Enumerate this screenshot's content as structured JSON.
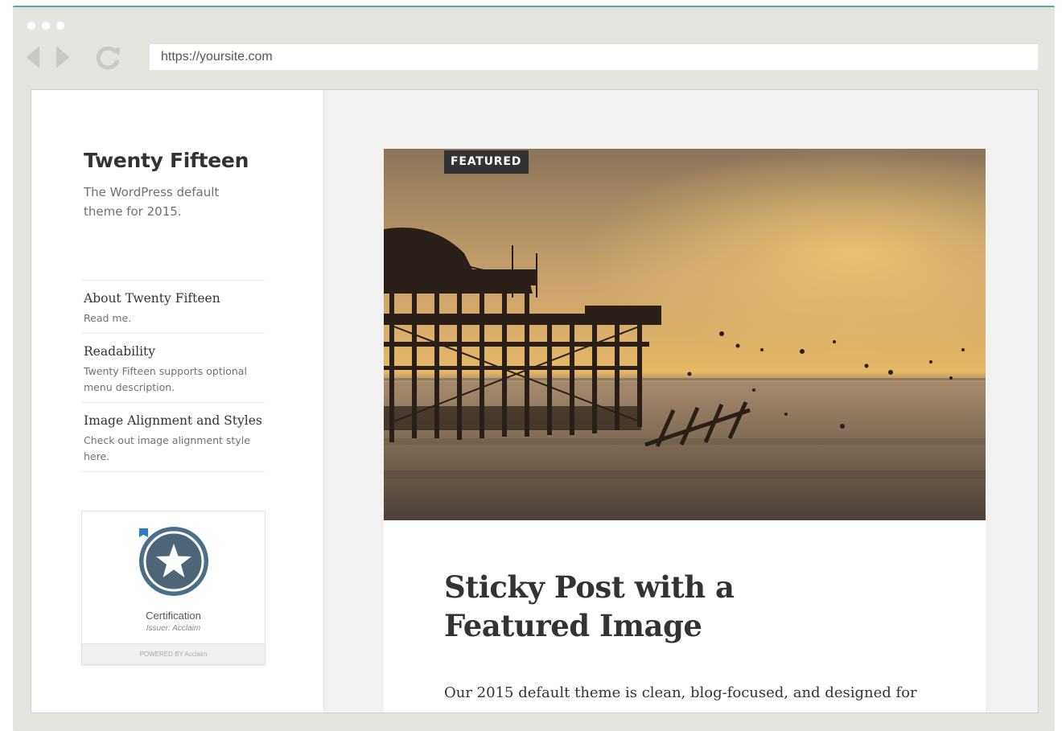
{
  "browser": {
    "url": "https://yoursite.com",
    "accent_color": "#57a7a7"
  },
  "sidebar": {
    "site_title": "Twenty Fifteen",
    "site_description": "The WordPress default theme for 2015.",
    "menu": [
      {
        "title": "About Twenty Fifteen",
        "description": "Read me."
      },
      {
        "title": "Readability",
        "description": "Twenty Fifteen supports optional menu description."
      },
      {
        "title": "Image Alignment and Styles",
        "description": "Check out image alignment style here."
      }
    ],
    "widget": {
      "badge_icon": "star-badge-icon",
      "name": "Certification",
      "issuer": "Issuer: Acclaim",
      "footer": "POWERED BY Acclaim"
    }
  },
  "post": {
    "label": "FEATURED",
    "title": "Sticky Post with a Featured Image",
    "excerpt": "Our 2015 default theme is clean, blog-focused, and designed for",
    "image_subject": "pier-sunset-photo"
  }
}
